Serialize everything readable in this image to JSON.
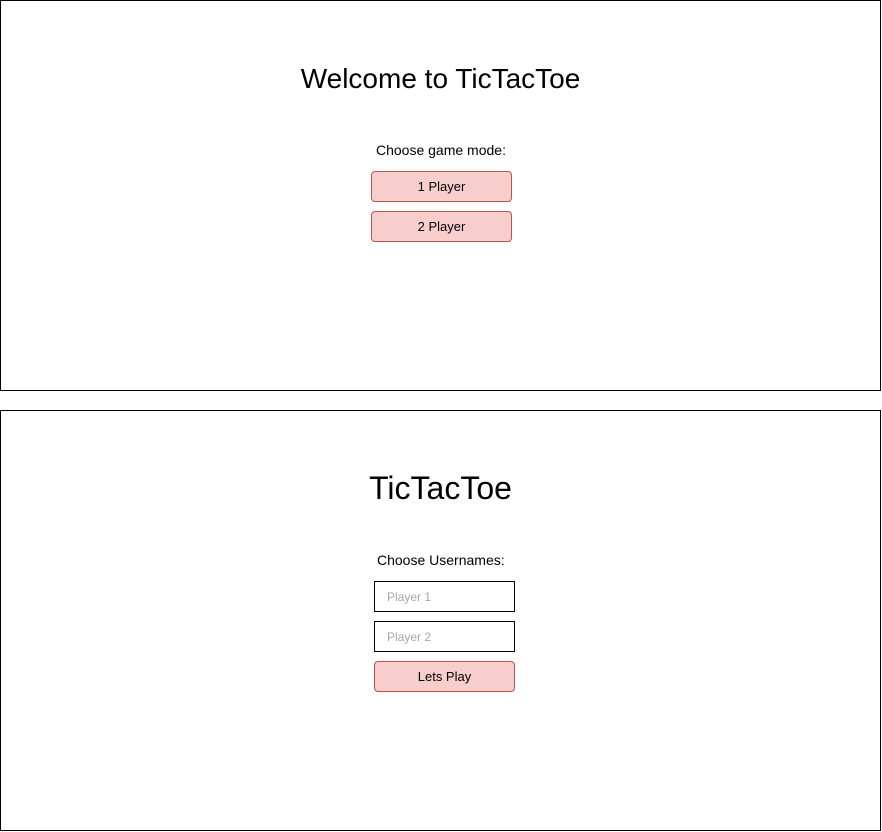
{
  "mode_screen": {
    "title": "Welcome to TicTacToe",
    "prompt": "Choose game mode:",
    "one_player_label": "1 Player",
    "two_player_label": "2 Player"
  },
  "username_screen": {
    "title": "TicTacToe",
    "prompt": "Choose Usernames:",
    "player1_placeholder": "Player 1",
    "player1_value": "",
    "player2_placeholder": "Player 2",
    "player2_value": "",
    "play_label": "Lets Play"
  },
  "colors": {
    "button_fill": "#f8cecc",
    "button_border": "#b85450",
    "panel_border": "#000000",
    "placeholder_text": "#a6a6a6"
  }
}
